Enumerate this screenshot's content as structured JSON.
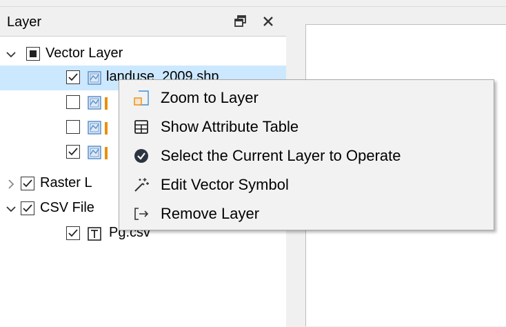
{
  "panel": {
    "title": "Layer"
  },
  "tree": {
    "vector_group": "Vector Layer",
    "layer1": "landuse_2009.shp",
    "raster_group": "Raster L",
    "csv_group": "CSV File",
    "csv_file": "Pg.csv"
  },
  "context_menu": {
    "items": [
      {
        "label": "Zoom to Layer",
        "icon": "zoom-to-layer-icon"
      },
      {
        "label": "Show Attribute Table",
        "icon": "table-icon"
      },
      {
        "label": "Select the Current Layer to Operate",
        "icon": "check-circle-icon"
      },
      {
        "label": "Edit Vector Symbol",
        "icon": "magic-wand-icon"
      },
      {
        "label": "Remove Layer",
        "icon": "remove-icon"
      }
    ]
  },
  "colors": {
    "selection": "#cce8ff",
    "layer_icon": "#5a8fc8",
    "orange": "#e8900c"
  }
}
